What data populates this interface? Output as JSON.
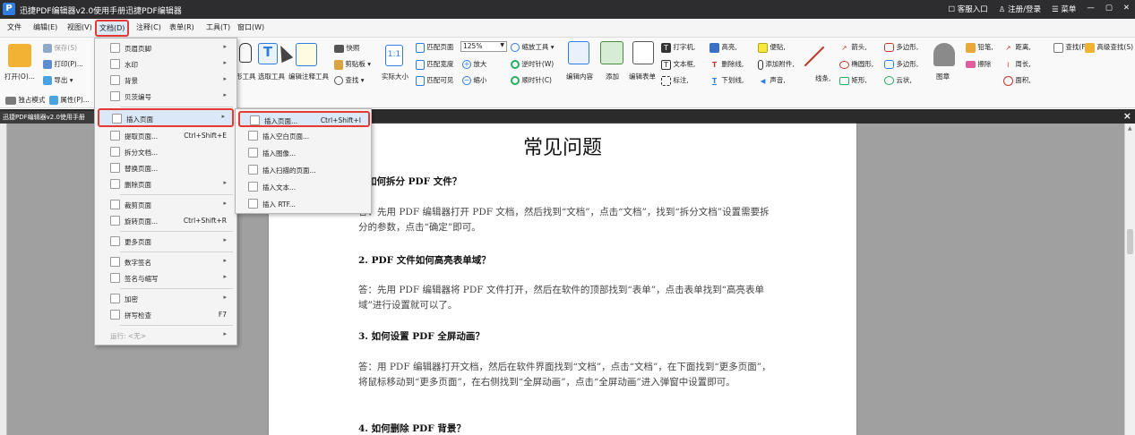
{
  "window": {
    "title": "迅捷PDF编辑器v2.0使用手册迅捷PDF编辑器",
    "logo_letter": "P",
    "right_items": [
      "客服入口",
      "注册/登录",
      "菜单"
    ],
    "controls": [
      "—",
      "▢",
      "✕"
    ]
  },
  "menubar": [
    "文件",
    "编辑(E)",
    "视图(V)",
    "文档(D)",
    "注释(C)",
    "表单(R)",
    "工具(T)",
    "窗口(W)"
  ],
  "menubar_active": "文档(D)",
  "ribbon": {
    "open": "打开(O)...",
    "save": "保存(S)",
    "print": "打印(P)...",
    "export": "导出",
    "single_mode": "独占模式",
    "properties": "属性(P)...",
    "hand_tool": "形工具",
    "select_tool": "选取工具",
    "edit_annot_tool": "编辑注释工具",
    "snapshot": "快照",
    "clipboard": "剪贴板",
    "find": "查找",
    "actual_size": "实际大小",
    "fit_page": "匹配页面",
    "fit_width": "匹配宽度",
    "fit_visible": "匹配可见",
    "zoom_value": "125%",
    "zoom_tool": "缩放工具",
    "zoom_in": "放大",
    "zoom_out": "缩小",
    "rotate_ccw": "逆时针(W)",
    "rotate_cw": "顺时针(C)",
    "edit_content": "编辑内容",
    "add": "添加",
    "edit_form": "编辑表单",
    "typewriter": "打字机",
    "textbox": "文本框",
    "callout": "标注",
    "highlight": "高亮",
    "strikeout": "删除线",
    "underline": "下划线",
    "sticky_note": "便贴",
    "attach_file": "添加附件",
    "sound": "声音",
    "line": "线条",
    "arrow": "箭头",
    "ellipse": "椭圆形",
    "rectangle": "矩形",
    "polygon": "多边形",
    "polyline": "多边形",
    "cloud": "云状",
    "stamp": "图章",
    "pencil": "铅笔",
    "eraser": "擦除",
    "distance": "距离",
    "perimeter": "周长",
    "area": "面积",
    "search": "查找(F)",
    "advanced_search": "高级查找(S)"
  },
  "doc_tab": "迅捷PDF编辑器v2.0使用手册",
  "dropdown": {
    "items": [
      {
        "label": "页眉页脚",
        "shortcut": "",
        "arrow": true
      },
      {
        "label": "水印",
        "shortcut": "",
        "arrow": true
      },
      {
        "label": "背景",
        "shortcut": "",
        "arrow": true
      },
      {
        "label": "贝茨编号",
        "shortcut": "",
        "arrow": true
      },
      {
        "label": "插入页面",
        "shortcut": "",
        "arrow": true
      },
      {
        "label": "提取页面...",
        "shortcut": "Ctrl+Shift+E",
        "arrow": false
      },
      {
        "label": "拆分文档...",
        "shortcut": "",
        "arrow": false
      },
      {
        "label": "替换页面...",
        "shortcut": "",
        "arrow": false
      },
      {
        "label": "删除页面",
        "shortcut": "",
        "arrow": true
      },
      {
        "label": "裁剪页面",
        "shortcut": "",
        "arrow": true
      },
      {
        "label": "旋转页面...",
        "shortcut": "Ctrl+Shift+R",
        "arrow": false
      },
      {
        "label": "更多页面",
        "shortcut": "",
        "arrow": true
      },
      {
        "label": "数字签名",
        "shortcut": "",
        "arrow": true
      },
      {
        "label": "签名与缩写",
        "shortcut": "",
        "arrow": true
      },
      {
        "label": "加密",
        "shortcut": "",
        "arrow": true
      },
      {
        "label": "拼写检查",
        "shortcut": "F7",
        "arrow": false
      },
      {
        "label": "运行: <无>",
        "shortcut": "",
        "arrow": true
      }
    ]
  },
  "submenu": {
    "items": [
      {
        "label": "插入页面...",
        "shortcut": "Ctrl+Shift+I"
      },
      {
        "label": "插入空白页面...",
        "shortcut": ""
      },
      {
        "label": "插入图像...",
        "shortcut": ""
      },
      {
        "label": "插入扫描的页面...",
        "shortcut": ""
      },
      {
        "label": "插入文本...",
        "shortcut": ""
      },
      {
        "label": "插入 RTF...",
        "shortcut": ""
      }
    ]
  },
  "document": {
    "title": "常见问题",
    "q1": "如何拆分 PDF 文件？",
    "a1": "答：先用 PDF 编辑器打开 PDF 文档，然后找到“文档”，点击“文档”，找到“拆分文档”设置需要拆分的参数，点击“确定”即可。",
    "q2": "2. PDF 文件如何高亮表单域？",
    "a2": "答：先用 PDF 编辑器将 PDF 文件打开，然后在软件的顶部找到“表单”，点击表单找到“高亮表单域”进行设置就可以了。",
    "q3": "3. 如何设置 PDF 全屏动画？",
    "a3": "答：用 PDF 编辑器打开文档，然后在软件界面找到“文档”，点击“文档”，在下面找到“更多页面”，将鼠标移动到“更多页面”，在右侧找到“全屏动画”，点击“全屏动画”进入弹窗中设置即可。",
    "q4": "4. 如何删除 PDF 背景？"
  },
  "colors": {
    "titlebar": "#2d2d30",
    "highlight_border": "#e53935",
    "workspace": "#a0a0a0",
    "accent": "#2f7de1"
  }
}
